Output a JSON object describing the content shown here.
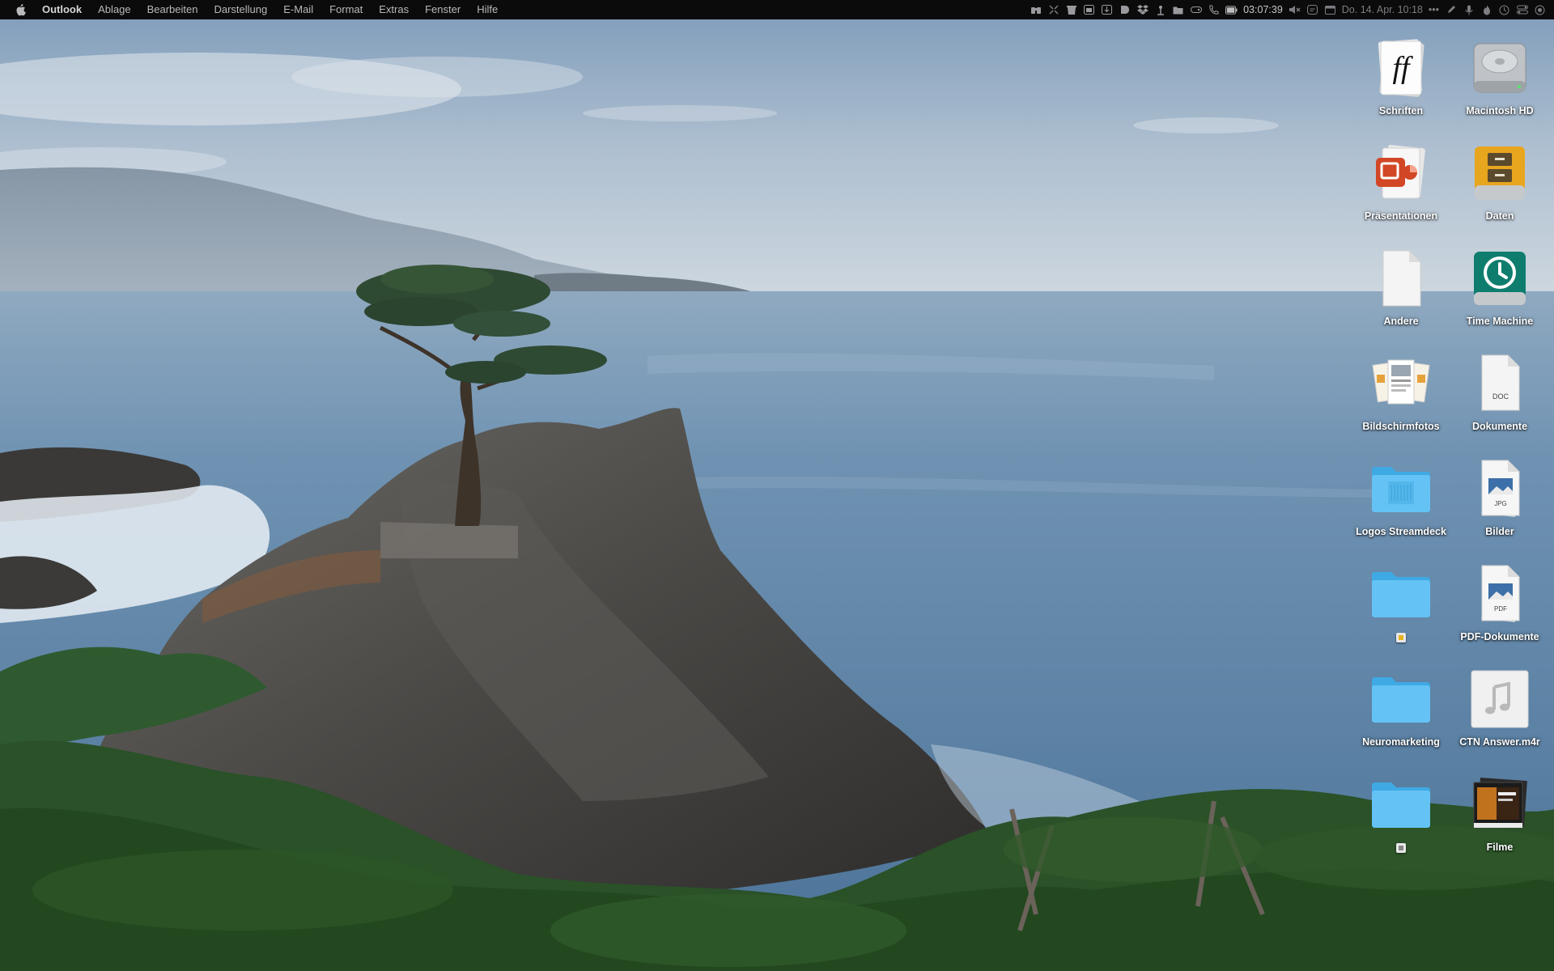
{
  "menubar": {
    "app_name": "Outlook",
    "menus": [
      "Ablage",
      "Bearbeiten",
      "Darstellung",
      "E-Mail",
      "Format",
      "Extras",
      "Fenster",
      "Hilfe"
    ],
    "timer": "03:07:39",
    "datetime": "Do. 14. Apr.  10:18",
    "overflow": "•••"
  },
  "desktop": {
    "icons": [
      {
        "label": "Schriften",
        "icon": "font-book-icon"
      },
      {
        "label": "Macintosh HD",
        "icon": "hard-drive-icon"
      },
      {
        "label": "Präsentationen",
        "icon": "powerpoint-stack-icon"
      },
      {
        "label": "Daten",
        "icon": "cabinet-drive-icon"
      },
      {
        "label": "Andere",
        "icon": "blank-document-icon"
      },
      {
        "label": "Time Machine",
        "icon": "time-machine-icon"
      },
      {
        "label": "Bildschirmfotos",
        "icon": "screenshots-stack-icon"
      },
      {
        "label": "Dokumente",
        "icon": "doc-stack-icon",
        "badge": "DOC"
      },
      {
        "label": "Logos Streamdeck",
        "icon": "folder-icon"
      },
      {
        "label": "Bilder",
        "icon": "jpg-stack-icon",
        "badge": "JPG"
      },
      {
        "label": "",
        "icon": "folder-icon"
      },
      {
        "label": "PDF-Dokumente",
        "icon": "pdf-stack-icon",
        "badge": "PDF"
      },
      {
        "label": "Neuromarketing",
        "icon": "folder-icon"
      },
      {
        "label": "CTN Answer.m4r",
        "icon": "music-file-icon"
      },
      {
        "label": "",
        "icon": "folder-icon"
      },
      {
        "label": "Filme",
        "icon": "movies-stack-icon"
      }
    ]
  },
  "colors": {
    "menubar_bg": "#0b0b0c",
    "folder_blue": "#5ac8fa",
    "sky": "#b7c9da",
    "ocean": "#5f86a8",
    "rock": "#4d4a47",
    "cypress": "#2e5a2e"
  }
}
